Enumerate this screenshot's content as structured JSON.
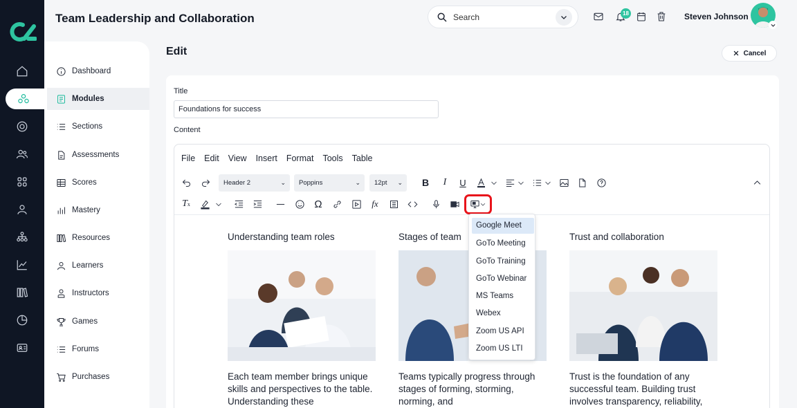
{
  "header": {
    "page_title": "Team Leadership and Collaboration",
    "search_placeholder": "Search",
    "notification_count": "18",
    "user_name": "Steven Johnson"
  },
  "sidebar": {
    "items": [
      {
        "label": "Dashboard",
        "icon": "info-circle-icon"
      },
      {
        "label": "Modules",
        "icon": "book-icon",
        "active": true
      },
      {
        "label": "Sections",
        "icon": "list-icon"
      },
      {
        "label": "Assessments",
        "icon": "document-icon"
      },
      {
        "label": "Scores",
        "icon": "table-icon"
      },
      {
        "label": "Mastery",
        "icon": "bar-chart-icon"
      },
      {
        "label": "Resources",
        "icon": "library-icon"
      },
      {
        "label": "Learners",
        "icon": "person-icon"
      },
      {
        "label": "Instructors",
        "icon": "instructor-icon"
      },
      {
        "label": "Games",
        "icon": "trophy-icon"
      },
      {
        "label": "Forums",
        "icon": "list-icon"
      },
      {
        "label": "Purchases",
        "icon": "cart-icon"
      }
    ]
  },
  "main": {
    "edit_title": "Edit",
    "cancel_label": "Cancel",
    "title_label": "Title",
    "title_value": "Foundations for success",
    "content_label": "Content"
  },
  "editor": {
    "menus": [
      "File",
      "Edit",
      "View",
      "Insert",
      "Format",
      "Tools",
      "Table"
    ],
    "block_format": "Header 2",
    "font_family": "Poppins",
    "font_size": "12pt"
  },
  "dropdown": {
    "items": [
      "Google Meet",
      "GoTo Meeting",
      "GoTo Training",
      "GoTo Webinar",
      "MS Teams",
      "Webex",
      "Zoom US API",
      "Zoom US LTI"
    ],
    "highlighted": "Google Meet"
  },
  "columns": [
    {
      "title": "Understanding team roles",
      "text": "Each team member brings unique skills and perspectives to the table. Understanding these"
    },
    {
      "title": "Stages of team",
      "text": "Teams typically progress through stages of forming, storming, norming, and"
    },
    {
      "title": "Trust and collaboration",
      "text": "Trust is the foundation of any successful team. Building trust involves transparency, reliability,"
    }
  ],
  "colors": {
    "accent": "#2ec4a0",
    "rail": "#0f1624",
    "highlight_border": "#e8141b"
  }
}
